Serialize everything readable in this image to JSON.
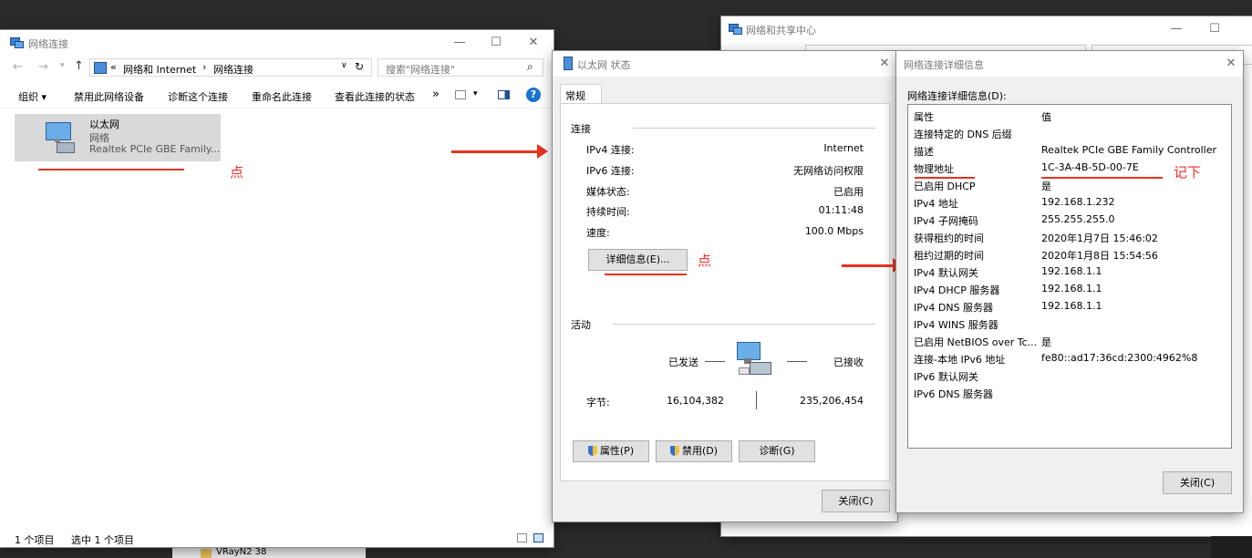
{
  "explorer": {
    "title": "网络连接",
    "address": [
      "网络和 Internet",
      "网络连接"
    ],
    "search_placeholder": "搜索\"网络连接\"",
    "toolbar": [
      "组织 ▾",
      "禁用此网络设备",
      "诊断这个连接",
      "重命名此连接",
      "查看此连接的状态",
      "»"
    ],
    "adapter": {
      "name": "以太网",
      "status": "网络",
      "device": "Realtek PCIe GBE Family..."
    },
    "status_bar": {
      "items": "1 个项目",
      "selected": "选中 1 个项目"
    },
    "annotation": "点",
    "below_item": "VRayN2 38"
  },
  "sharing": {
    "title": "网络和共享中心"
  },
  "status_dialog": {
    "title": "以太网 状态",
    "tab": "常规",
    "connection_group": "连接",
    "rows": [
      {
        "label": "IPv4 连接:",
        "value": "Internet"
      },
      {
        "label": "IPv6 连接:",
        "value": "无网络访问权限"
      },
      {
        "label": "媒体状态:",
        "value": "已启用"
      },
      {
        "label": "持续时间:",
        "value": "01:11:48"
      },
      {
        "label": "速度:",
        "value": "100.0 Mbps"
      }
    ],
    "details_button": "详细信息(E)...",
    "annotation": "点",
    "activity_group": "活动",
    "sent_label": "已发送",
    "received_label": "已接收",
    "bytes_label": "字节:",
    "bytes_sent": "16,104,382",
    "bytes_received": "235,206,454",
    "properties_button": "属性(P)",
    "disable_button": "禁用(D)",
    "diagnose_button": "诊断(G)",
    "close_button": "关闭(C)"
  },
  "details_dialog": {
    "title": "网络连接详细信息",
    "list_label": "网络连接详细信息(D):",
    "col_property": "属性",
    "col_value": "值",
    "rows": [
      {
        "p": "连接特定的 DNS 后缀",
        "v": ""
      },
      {
        "p": "描述",
        "v": "Realtek PCIe GBE Family Controller"
      },
      {
        "p": "物理地址",
        "v": "1C-3A-4B-5D-00-7E"
      },
      {
        "p": "已启用 DHCP",
        "v": "是"
      },
      {
        "p": "IPv4 地址",
        "v": "192.168.1.232"
      },
      {
        "p": "IPv4 子网掩码",
        "v": "255.255.255.0"
      },
      {
        "p": "获得租约的时间",
        "v": "2020年1月7日 15:46:02"
      },
      {
        "p": "租约过期的时间",
        "v": "2020年1月8日 15:54:56"
      },
      {
        "p": "IPv4 默认网关",
        "v": "192.168.1.1"
      },
      {
        "p": "IPv4 DHCP 服务器",
        "v": "192.168.1.1"
      },
      {
        "p": "IPv4 DNS 服务器",
        "v": "192.168.1.1"
      },
      {
        "p": "IPv4 WINS 服务器",
        "v": ""
      },
      {
        "p": "已启用 NetBIOS over Tc...",
        "v": "是"
      },
      {
        "p": "连接-本地 IPv6 地址",
        "v": "fe80::ad17:36cd:2300:4962%8"
      },
      {
        "p": "IPv6 默认网关",
        "v": ""
      },
      {
        "p": "IPv6 DNS 服务器",
        "v": ""
      }
    ],
    "annotation": "记下",
    "close_button": "关闭(C)"
  },
  "colors": {
    "annotation_red": "#e8321e",
    "selection": "#cce8ff"
  }
}
